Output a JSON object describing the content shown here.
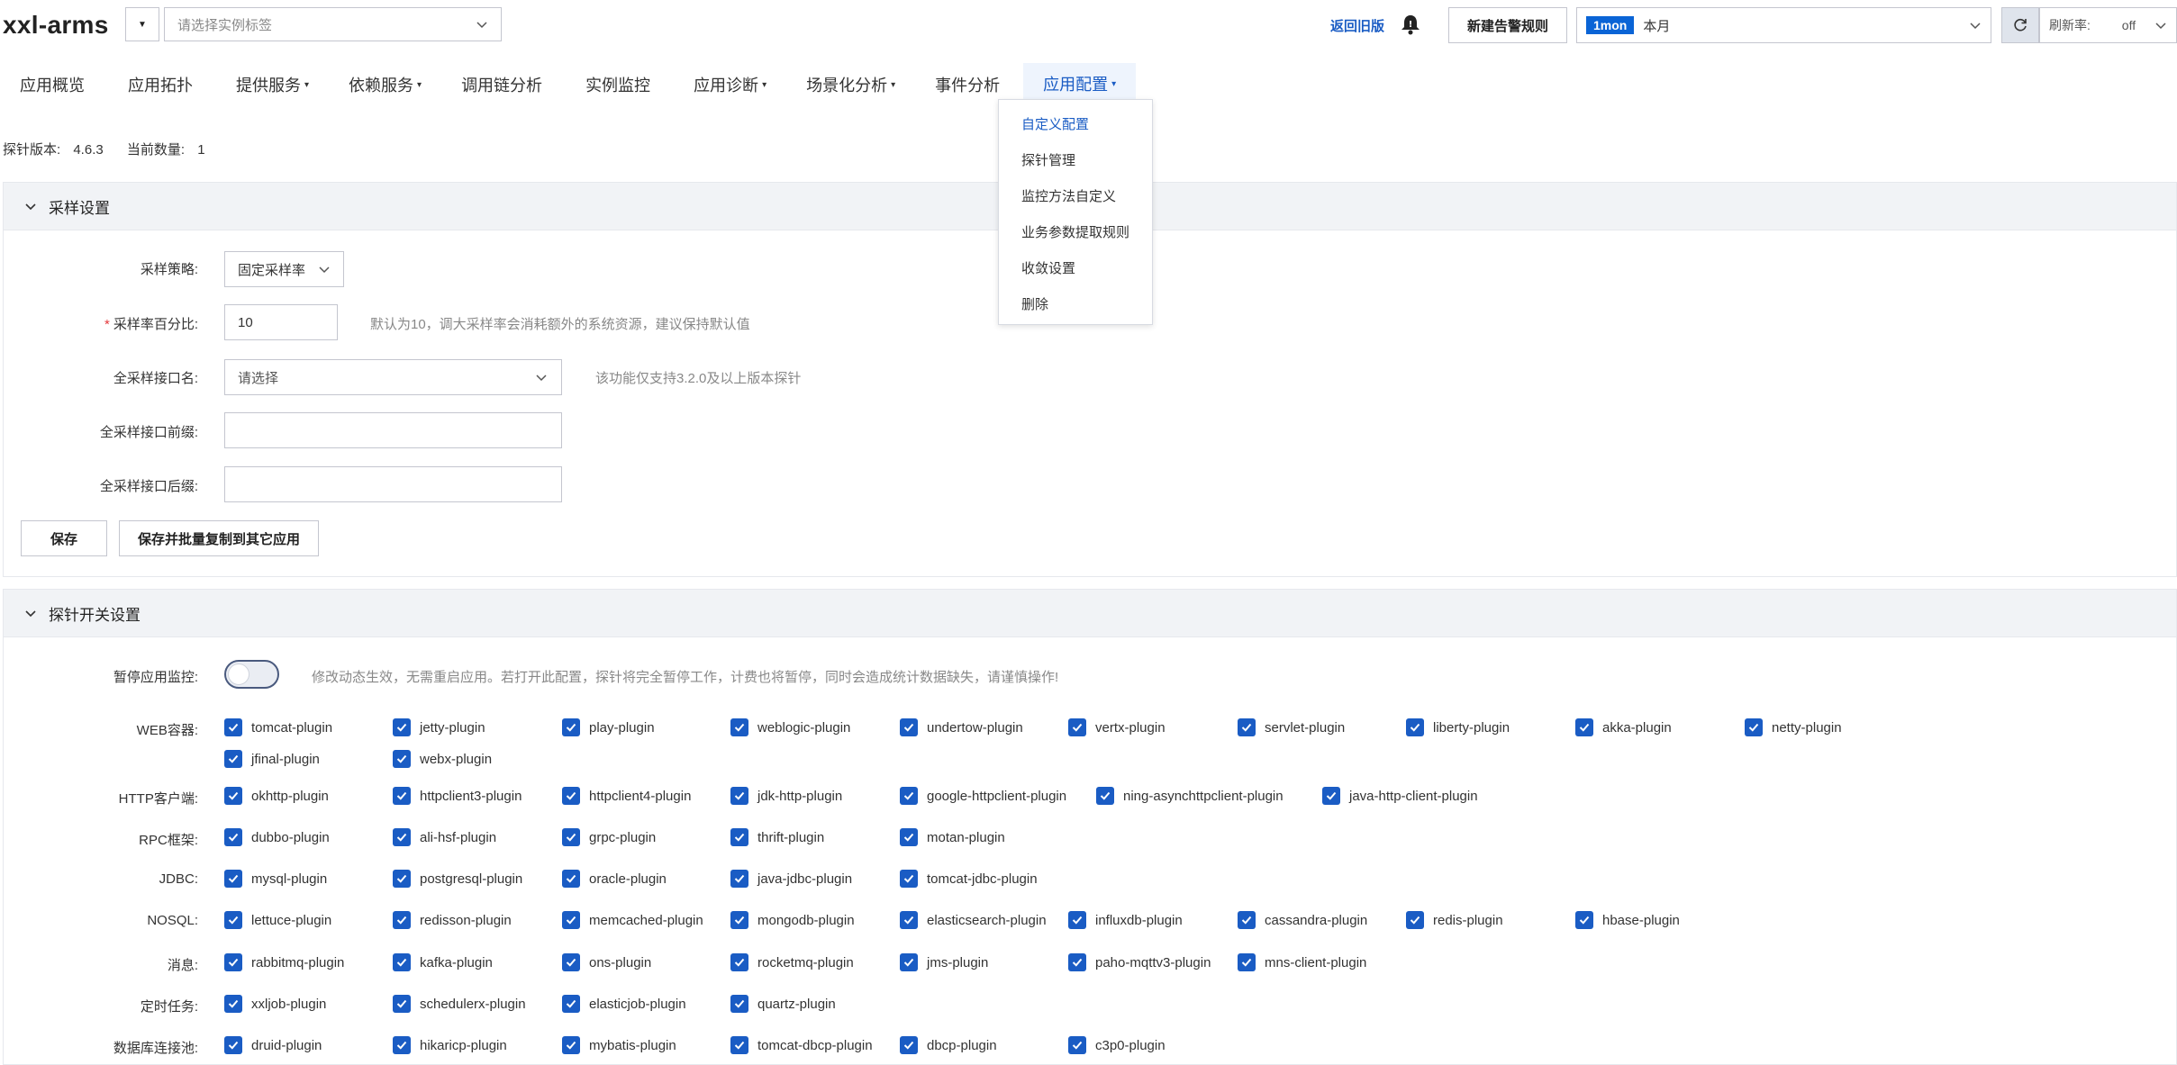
{
  "header": {
    "app_title": "xxl-arms",
    "instance_placeholder": "请选择实例标签",
    "back_link": "返回旧版",
    "new_alert_label": "新建告警规则",
    "time_badge": "1mon",
    "time_label": "本月",
    "refresh_label": "刷新率:",
    "refresh_value": "off"
  },
  "nav": {
    "items": [
      {
        "label": "应用概览",
        "caret": ""
      },
      {
        "label": "应用拓扑",
        "caret": ""
      },
      {
        "label": "提供服务",
        "caret": "▾"
      },
      {
        "label": "依赖服务",
        "caret": "▾"
      },
      {
        "label": "调用链分析",
        "caret": ""
      },
      {
        "label": "实例监控",
        "caret": ""
      },
      {
        "label": "应用诊断",
        "caret": "▾"
      },
      {
        "label": "场景化分析",
        "caret": "▾"
      },
      {
        "label": "事件分析",
        "caret": ""
      },
      {
        "label": "应用配置",
        "caret": "▾"
      }
    ],
    "dropdown": [
      "自定义配置",
      "探针管理",
      "监控方法自定义",
      "业务参数提取规则",
      "收敛设置",
      "删除"
    ]
  },
  "probe_info": {
    "version_label": "探针版本:",
    "version": "4.6.3",
    "count_label": "当前数量:",
    "count": "1"
  },
  "sampling": {
    "title": "采样设置",
    "strategy_label": "采样策略:",
    "strategy_value": "固定采样率",
    "percent_label": "采样率百分比:",
    "percent_value": "10",
    "percent_hint": "默认为10，调大采样率会消耗额外的系统资源，建议保持默认值",
    "full_interface_label": "全采样接口名:",
    "full_interface_placeholder": "请选择",
    "full_interface_hint": "该功能仅支持3.2.0及以上版本探针",
    "prefix_label": "全采样接口前缀:",
    "suffix_label": "全采样接口后缀:",
    "save_label": "保存",
    "save_copy_label": "保存并批量复制到其它应用"
  },
  "probe_switch": {
    "title": "探针开关设置",
    "pause_label": "暂停应用监控:",
    "pause_hint": "修改动态生效，无需重启应用。若打开此配置，探针将完全暂停工作，计费也将暂停，同时会造成统计数据缺失，请谨慎操作!",
    "pause_on": false,
    "groups": [
      {
        "label": "WEB容器:",
        "plugins": [
          "tomcat-plugin",
          "jetty-plugin",
          "play-plugin",
          "weblogic-plugin",
          "undertow-plugin",
          "vertx-plugin",
          "servlet-plugin",
          "liberty-plugin",
          "akka-plugin",
          "netty-plugin",
          "jfinal-plugin",
          "webx-plugin"
        ]
      },
      {
        "label": "HTTP客户端:",
        "plugins": [
          "okhttp-plugin",
          "httpclient3-plugin",
          "httpclient4-plugin",
          "jdk-http-plugin",
          "google-httpclient-plugin",
          "ning-asynchttpclient-plugin",
          "java-http-client-plugin"
        ]
      },
      {
        "label": "RPC框架:",
        "plugins": [
          "dubbo-plugin",
          "ali-hsf-plugin",
          "grpc-plugin",
          "thrift-plugin",
          "motan-plugin"
        ]
      },
      {
        "label": "JDBC:",
        "plugins": [
          "mysql-plugin",
          "postgresql-plugin",
          "oracle-plugin",
          "java-jdbc-plugin",
          "tomcat-jdbc-plugin"
        ]
      },
      {
        "label": "NOSQL:",
        "plugins": [
          "lettuce-plugin",
          "redisson-plugin",
          "memcached-plugin",
          "mongodb-plugin",
          "elasticsearch-plugin",
          "influxdb-plugin",
          "cassandra-plugin",
          "redis-plugin",
          "hbase-plugin"
        ]
      },
      {
        "label": "消息:",
        "plugins": [
          "rabbitmq-plugin",
          "kafka-plugin",
          "ons-plugin",
          "rocketmq-plugin",
          "jms-plugin",
          "paho-mqttv3-plugin",
          "mns-client-plugin"
        ]
      },
      {
        "label": "定时任务:",
        "plugins": [
          "xxljob-plugin",
          "schedulerx-plugin",
          "elasticjob-plugin",
          "quartz-plugin"
        ]
      },
      {
        "label": "数据库连接池:",
        "plugins": [
          "druid-plugin",
          "hikaricp-plugin",
          "mybatis-plugin",
          "tomcat-dbcp-plugin",
          "dbcp-plugin",
          "c3p0-plugin"
        ]
      }
    ]
  }
}
